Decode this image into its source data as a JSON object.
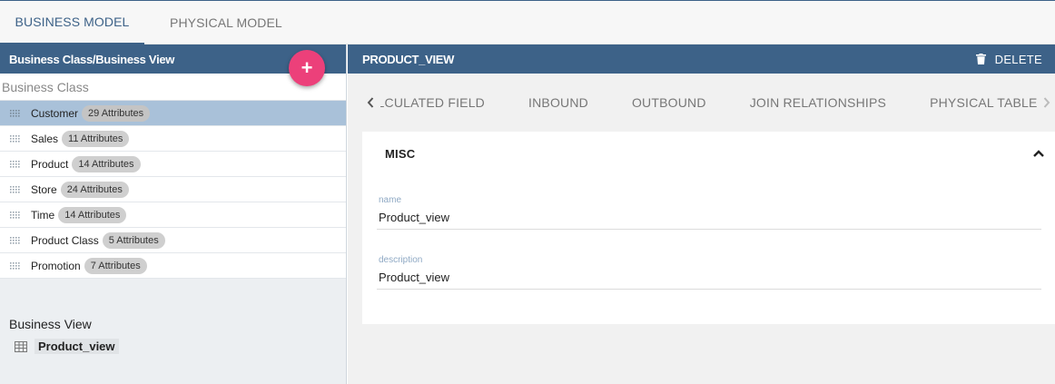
{
  "top_tabs": [
    {
      "label": "BUSINESS MODEL",
      "active": true
    },
    {
      "label": "PHYSICAL MODEL",
      "active": false
    }
  ],
  "left": {
    "header": "Business Class/Business View",
    "add_button": "+",
    "section_label": "Business Class",
    "classes": [
      {
        "name": "Customer",
        "attrs": "29 Attributes",
        "selected": true
      },
      {
        "name": "Sales",
        "attrs": "11 Attributes"
      },
      {
        "name": "Product",
        "attrs": "14 Attributes"
      },
      {
        "name": "Store",
        "attrs": "24 Attributes"
      },
      {
        "name": "Time",
        "attrs": "14 Attributes"
      },
      {
        "name": "Product Class",
        "attrs": "5 Attributes"
      },
      {
        "name": "Promotion",
        "attrs": "7 Attributes"
      }
    ],
    "business_view_label": "Business View",
    "business_view_item": "Product_view"
  },
  "right": {
    "title": "PRODUCT_VIEW",
    "delete_label": "DELETE",
    "sub_tabs": [
      "CALCULATED FIELD",
      "INBOUND",
      "OUTBOUND",
      "JOIN RELATIONSHIPS",
      "PHYSICAL TABLE"
    ],
    "card": {
      "title": "MISC",
      "fields": [
        {
          "label": "name",
          "value": "Product_view"
        },
        {
          "label": "description",
          "value": "Product_view"
        }
      ]
    }
  },
  "colors": {
    "header": "#3d6288",
    "fab": "#ec407a",
    "selected_row": "#a9c1d9"
  },
  "icons": [
    "drag-handle-icon",
    "table-icon",
    "trash-icon",
    "chevron-left-icon",
    "chevron-right-icon",
    "chevron-up-icon",
    "plus-icon"
  ]
}
